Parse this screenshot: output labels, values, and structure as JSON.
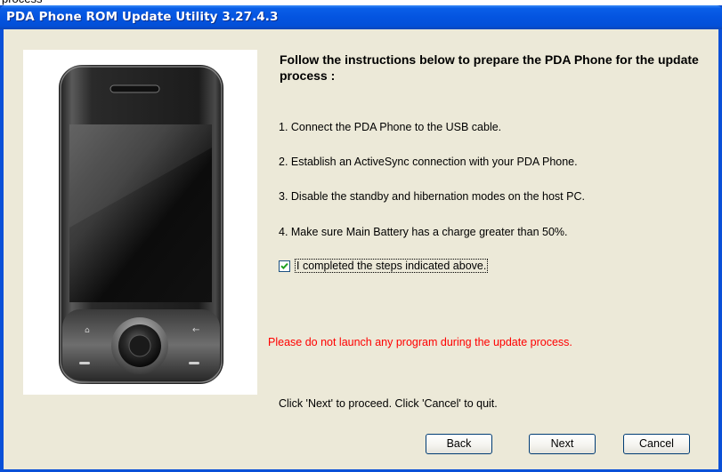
{
  "background_text": "process",
  "window": {
    "title": "PDA Phone ROM Update Utility 3.27.4.3"
  },
  "instructions": {
    "heading": "Follow the instructions below to prepare the PDA Phone for the update process :",
    "steps": [
      "1. Connect the PDA Phone to the USB cable.",
      "2. Establish an ActiveSync connection with your PDA Phone.",
      "3. Disable the standby and hibernation modes on the host PC.",
      "4. Make sure Main Battery has a charge greater than 50%."
    ],
    "checkbox": {
      "label": "I completed the steps indicated above.",
      "checked": true
    },
    "warning": "Please do not launch any program during the update process.",
    "hint": "Click 'Next' to proceed. Click 'Cancel' to quit."
  },
  "buttons": {
    "back": "Back",
    "next": "Next",
    "cancel": "Cancel"
  },
  "colors": {
    "titlebar": "#0454e0",
    "dialog_bg": "#ece9d8",
    "warning": "#ff0000"
  },
  "icons": [
    "phone-device-image",
    "checkmark-icon"
  ]
}
